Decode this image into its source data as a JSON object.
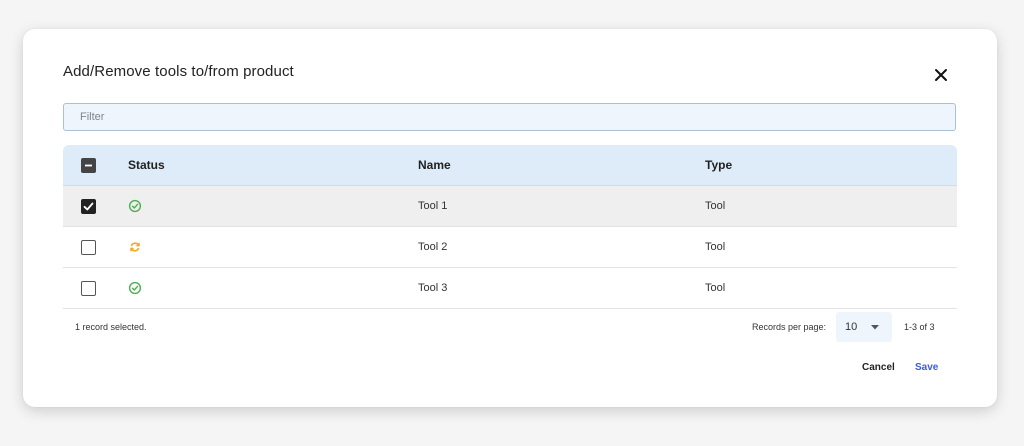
{
  "dialog": {
    "title": "Add/Remove tools to/from product",
    "close_icon": "close-icon"
  },
  "filter": {
    "placeholder": "Filter",
    "value": ""
  },
  "table": {
    "columns": [
      "Status",
      "Name",
      "Type"
    ],
    "header_checkbox_state": "indeterminate",
    "rows": [
      {
        "selected": true,
        "status": "success",
        "status_icon": "check-circle-icon",
        "status_color": "#4caf50",
        "name": "Tool 1",
        "type": "Tool"
      },
      {
        "selected": false,
        "status": "syncing",
        "status_icon": "sync-icon",
        "status_color": "#f5a623",
        "name": "Tool 2",
        "type": "Tool"
      },
      {
        "selected": false,
        "status": "success",
        "status_icon": "check-circle-icon",
        "status_color": "#4caf50",
        "name": "Tool 3",
        "type": "Tool"
      }
    ]
  },
  "footer": {
    "selection_text": "1 record selected.",
    "records_per_page_label": "Records per page:",
    "records_per_page_value": "10",
    "page_range": "1-3 of 3"
  },
  "actions": {
    "cancel_label": "Cancel",
    "save_label": "Save"
  },
  "colors": {
    "header_bg": "#deecf9",
    "filter_bg": "#eef5fd",
    "save_color": "#3b5bdb",
    "selected_row_bg": "#efefef"
  }
}
